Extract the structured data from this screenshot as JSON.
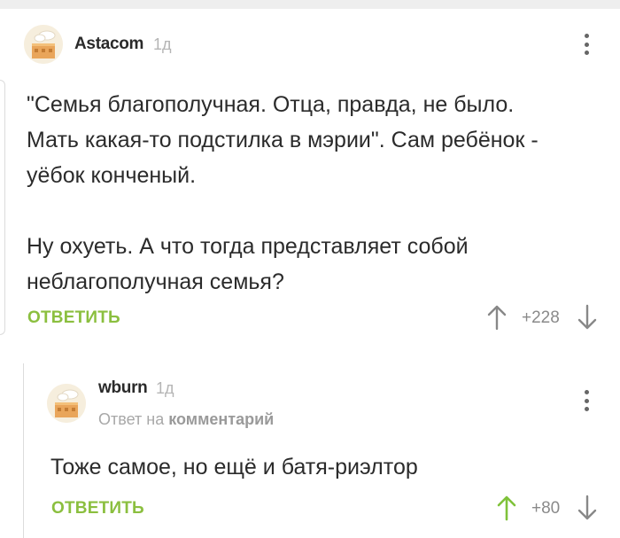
{
  "comments": [
    {
      "username": "Astacom",
      "time": "1д",
      "paragraphs": [
        "\"Семья благополучная. Отца, правда, не было.",
        "Мать какая-то подстилка в мэрии\". Сам ребёнок -",
        "уёбок конченый.",
        "",
        "Ну охуеть. А что тогда представляет собой",
        "неблагополучная семья?"
      ],
      "reply_label": "ОТВЕТИТЬ",
      "rating": "+228"
    },
    {
      "username": "wburn",
      "time": "1д",
      "reply_to_prefix": "Ответ на",
      "reply_to_target": "комментарий",
      "paragraphs": [
        "Тоже самое, но ещё и батя-риэлтор"
      ],
      "reply_label": "ОТВЕТИТЬ",
      "rating": "+80"
    }
  ],
  "colors": {
    "accent_green": "#8bbf3f",
    "upvoted_arrow": "#7fc23a",
    "neutral_arrow": "#888888"
  },
  "icons": {
    "menu": "more-vertical-icon",
    "upvote": "arrow-up-icon",
    "downvote": "arrow-down-icon"
  }
}
